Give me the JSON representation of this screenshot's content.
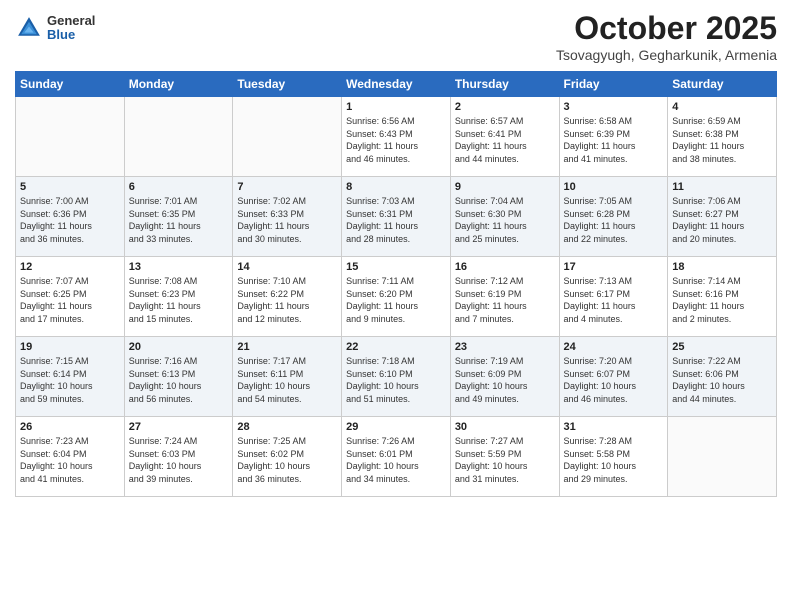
{
  "header": {
    "logo_general": "General",
    "logo_blue": "Blue",
    "title": "October 2025",
    "subtitle": "Tsovagyugh, Gegharkunik, Armenia"
  },
  "calendar": {
    "days_of_week": [
      "Sunday",
      "Monday",
      "Tuesday",
      "Wednesday",
      "Thursday",
      "Friday",
      "Saturday"
    ],
    "weeks": [
      [
        {
          "day": "",
          "info": ""
        },
        {
          "day": "",
          "info": ""
        },
        {
          "day": "",
          "info": ""
        },
        {
          "day": "1",
          "info": "Sunrise: 6:56 AM\nSunset: 6:43 PM\nDaylight: 11 hours\nand 46 minutes."
        },
        {
          "day": "2",
          "info": "Sunrise: 6:57 AM\nSunset: 6:41 PM\nDaylight: 11 hours\nand 44 minutes."
        },
        {
          "day": "3",
          "info": "Sunrise: 6:58 AM\nSunset: 6:39 PM\nDaylight: 11 hours\nand 41 minutes."
        },
        {
          "day": "4",
          "info": "Sunrise: 6:59 AM\nSunset: 6:38 PM\nDaylight: 11 hours\nand 38 minutes."
        }
      ],
      [
        {
          "day": "5",
          "info": "Sunrise: 7:00 AM\nSunset: 6:36 PM\nDaylight: 11 hours\nand 36 minutes."
        },
        {
          "day": "6",
          "info": "Sunrise: 7:01 AM\nSunset: 6:35 PM\nDaylight: 11 hours\nand 33 minutes."
        },
        {
          "day": "7",
          "info": "Sunrise: 7:02 AM\nSunset: 6:33 PM\nDaylight: 11 hours\nand 30 minutes."
        },
        {
          "day": "8",
          "info": "Sunrise: 7:03 AM\nSunset: 6:31 PM\nDaylight: 11 hours\nand 28 minutes."
        },
        {
          "day": "9",
          "info": "Sunrise: 7:04 AM\nSunset: 6:30 PM\nDaylight: 11 hours\nand 25 minutes."
        },
        {
          "day": "10",
          "info": "Sunrise: 7:05 AM\nSunset: 6:28 PM\nDaylight: 11 hours\nand 22 minutes."
        },
        {
          "day": "11",
          "info": "Sunrise: 7:06 AM\nSunset: 6:27 PM\nDaylight: 11 hours\nand 20 minutes."
        }
      ],
      [
        {
          "day": "12",
          "info": "Sunrise: 7:07 AM\nSunset: 6:25 PM\nDaylight: 11 hours\nand 17 minutes."
        },
        {
          "day": "13",
          "info": "Sunrise: 7:08 AM\nSunset: 6:23 PM\nDaylight: 11 hours\nand 15 minutes."
        },
        {
          "day": "14",
          "info": "Sunrise: 7:10 AM\nSunset: 6:22 PM\nDaylight: 11 hours\nand 12 minutes."
        },
        {
          "day": "15",
          "info": "Sunrise: 7:11 AM\nSunset: 6:20 PM\nDaylight: 11 hours\nand 9 minutes."
        },
        {
          "day": "16",
          "info": "Sunrise: 7:12 AM\nSunset: 6:19 PM\nDaylight: 11 hours\nand 7 minutes."
        },
        {
          "day": "17",
          "info": "Sunrise: 7:13 AM\nSunset: 6:17 PM\nDaylight: 11 hours\nand 4 minutes."
        },
        {
          "day": "18",
          "info": "Sunrise: 7:14 AM\nSunset: 6:16 PM\nDaylight: 11 hours\nand 2 minutes."
        }
      ],
      [
        {
          "day": "19",
          "info": "Sunrise: 7:15 AM\nSunset: 6:14 PM\nDaylight: 10 hours\nand 59 minutes."
        },
        {
          "day": "20",
          "info": "Sunrise: 7:16 AM\nSunset: 6:13 PM\nDaylight: 10 hours\nand 56 minutes."
        },
        {
          "day": "21",
          "info": "Sunrise: 7:17 AM\nSunset: 6:11 PM\nDaylight: 10 hours\nand 54 minutes."
        },
        {
          "day": "22",
          "info": "Sunrise: 7:18 AM\nSunset: 6:10 PM\nDaylight: 10 hours\nand 51 minutes."
        },
        {
          "day": "23",
          "info": "Sunrise: 7:19 AM\nSunset: 6:09 PM\nDaylight: 10 hours\nand 49 minutes."
        },
        {
          "day": "24",
          "info": "Sunrise: 7:20 AM\nSunset: 6:07 PM\nDaylight: 10 hours\nand 46 minutes."
        },
        {
          "day": "25",
          "info": "Sunrise: 7:22 AM\nSunset: 6:06 PM\nDaylight: 10 hours\nand 44 minutes."
        }
      ],
      [
        {
          "day": "26",
          "info": "Sunrise: 7:23 AM\nSunset: 6:04 PM\nDaylight: 10 hours\nand 41 minutes."
        },
        {
          "day": "27",
          "info": "Sunrise: 7:24 AM\nSunset: 6:03 PM\nDaylight: 10 hours\nand 39 minutes."
        },
        {
          "day": "28",
          "info": "Sunrise: 7:25 AM\nSunset: 6:02 PM\nDaylight: 10 hours\nand 36 minutes."
        },
        {
          "day": "29",
          "info": "Sunrise: 7:26 AM\nSunset: 6:01 PM\nDaylight: 10 hours\nand 34 minutes."
        },
        {
          "day": "30",
          "info": "Sunrise: 7:27 AM\nSunset: 5:59 PM\nDaylight: 10 hours\nand 31 minutes."
        },
        {
          "day": "31",
          "info": "Sunrise: 7:28 AM\nSunset: 5:58 PM\nDaylight: 10 hours\nand 29 minutes."
        },
        {
          "day": "",
          "info": ""
        }
      ]
    ]
  }
}
